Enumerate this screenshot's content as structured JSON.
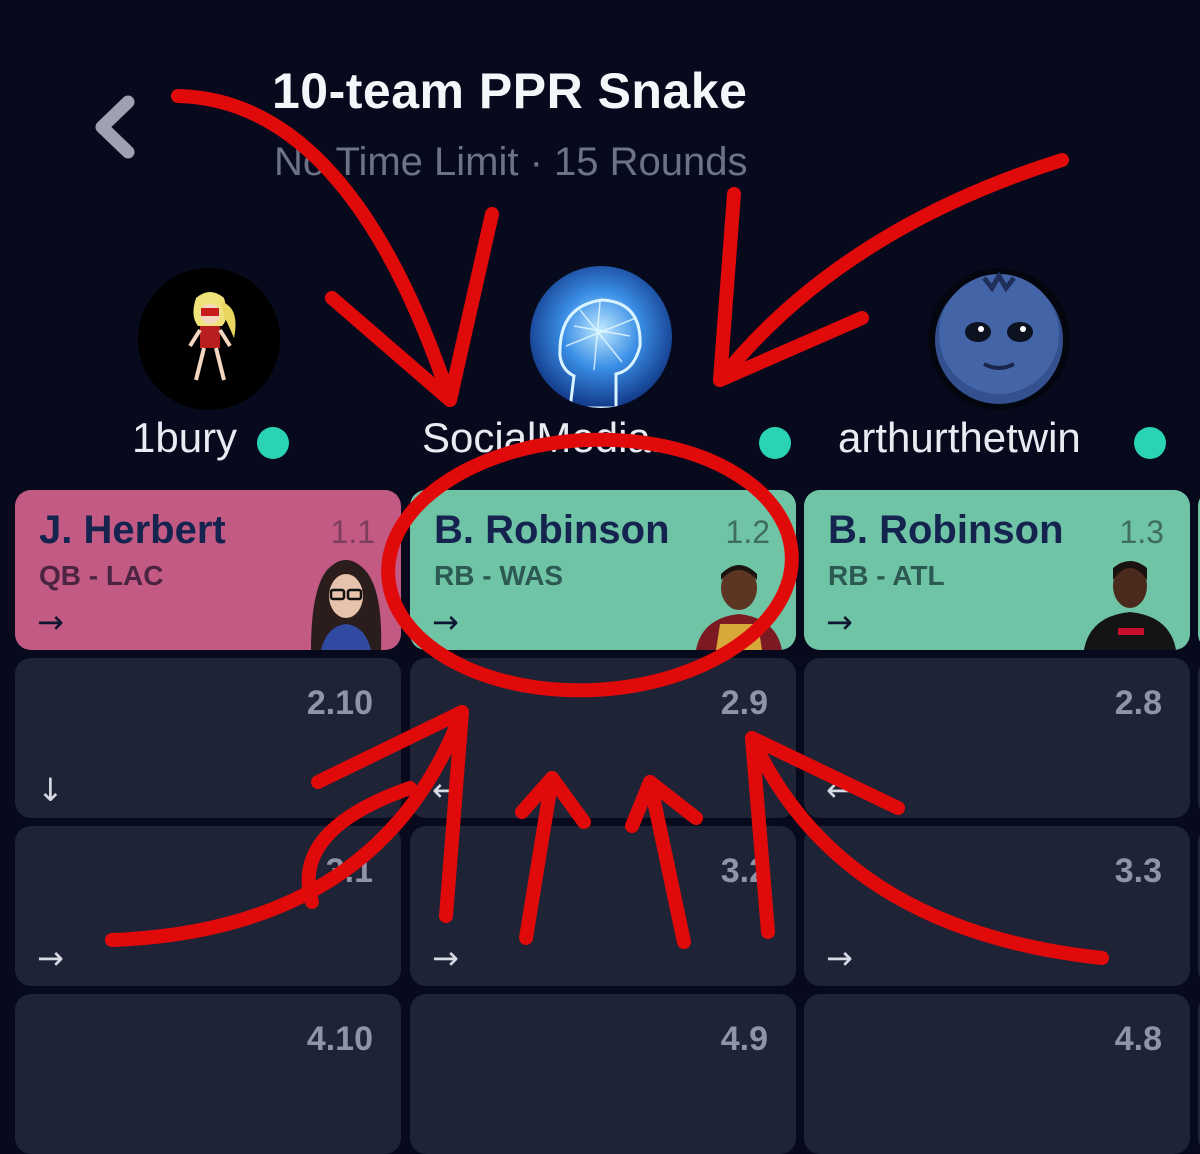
{
  "header": {
    "title": "10-team PPR Snake",
    "subtitle": "No Time Limit · 15 Rounds"
  },
  "teams": [
    {
      "name": "1bury",
      "online": true
    },
    {
      "name": "SocialMedia...",
      "online": true
    },
    {
      "name": "arthurthetwin",
      "online": true
    }
  ],
  "picks": [
    {
      "player": "J. Herbert",
      "position": "QB - LAC",
      "pick": "1.1",
      "direction": "→"
    },
    {
      "player": "B. Robinson",
      "position": "RB - WAS",
      "pick": "1.2",
      "direction": "→"
    },
    {
      "player": "B. Robinson",
      "position": "RB - ATL",
      "pick": "1.3",
      "direction": "→"
    }
  ],
  "rows": [
    [
      {
        "pick": "2.10",
        "direction": "↓"
      },
      {
        "pick": "2.9",
        "direction": "←"
      },
      {
        "pick": "2.8",
        "direction": "←"
      }
    ],
    [
      {
        "pick": "3.1",
        "direction": "→"
      },
      {
        "pick": "3.2",
        "direction": "→"
      },
      {
        "pick": "3.3",
        "direction": "→"
      }
    ],
    [
      {
        "pick": "4.10",
        "direction": ""
      },
      {
        "pick": "4.9",
        "direction": ""
      },
      {
        "pick": "4.8",
        "direction": ""
      }
    ]
  ],
  "colors": {
    "background": "#070a1c",
    "online_dot": "#2ad3b3",
    "qb_card": "#c25a84",
    "rb_card": "#6fc4a6",
    "empty_cell": "#1e2336",
    "annotation_red": "#e10a0a"
  },
  "icons": [
    "back-chevron-icon",
    "online-status-icon",
    "arrow-right-icon",
    "arrow-left-icon",
    "arrow-down-icon"
  ]
}
